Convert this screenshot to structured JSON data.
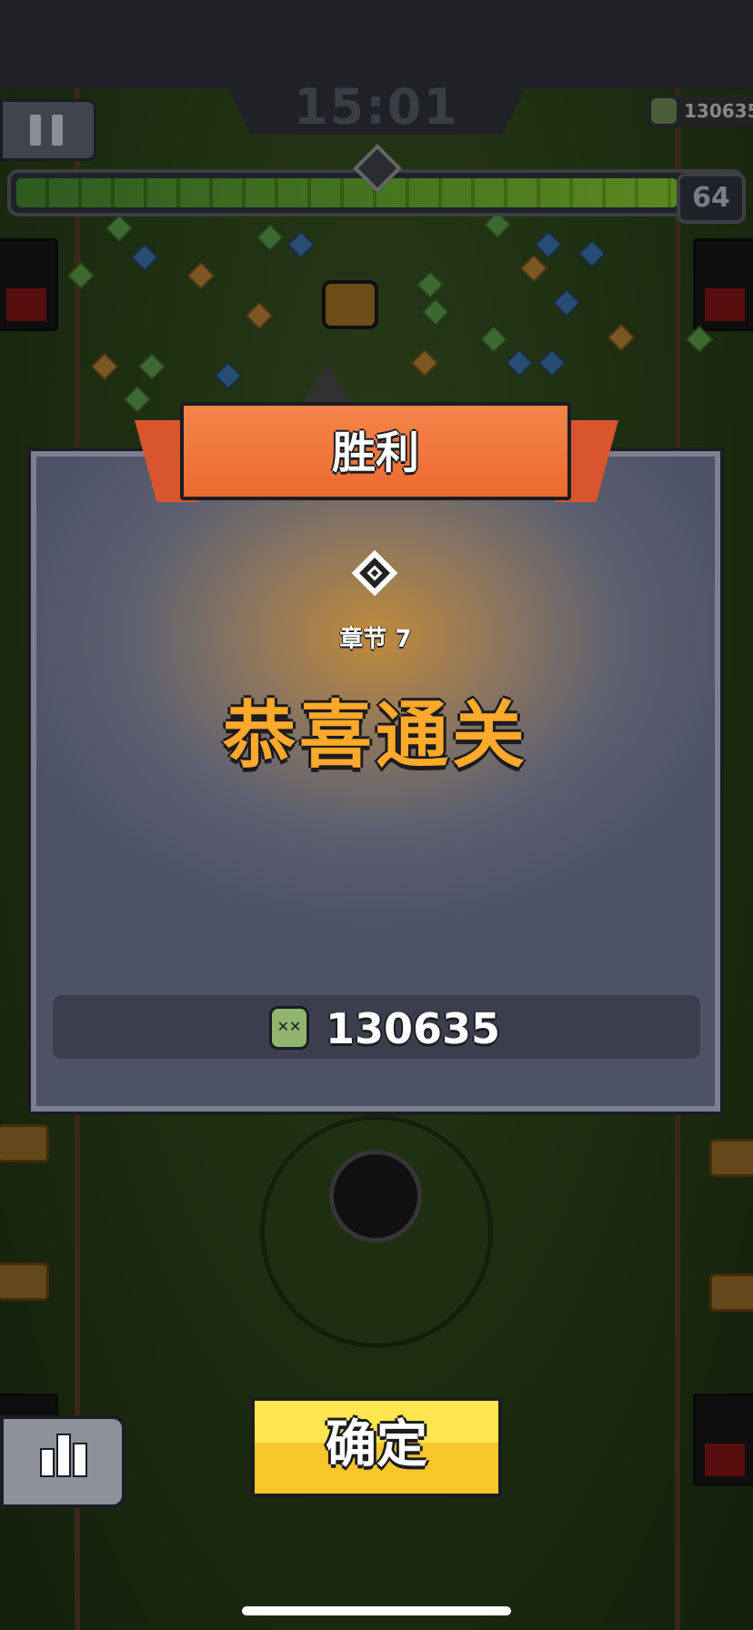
{
  "hud": {
    "timer": "15:01",
    "kills": "130635",
    "level": "64",
    "xp_progress": 0.92
  },
  "victory": {
    "title": "胜利",
    "chapter": "章节 7",
    "headline": "恭喜通关",
    "kill_count": "130635"
  },
  "buttons": {
    "confirm": "确定"
  },
  "colors": {
    "ribbon": "#ec6a30",
    "headline": "#ffa92b",
    "confirm": "#f6c62a"
  }
}
